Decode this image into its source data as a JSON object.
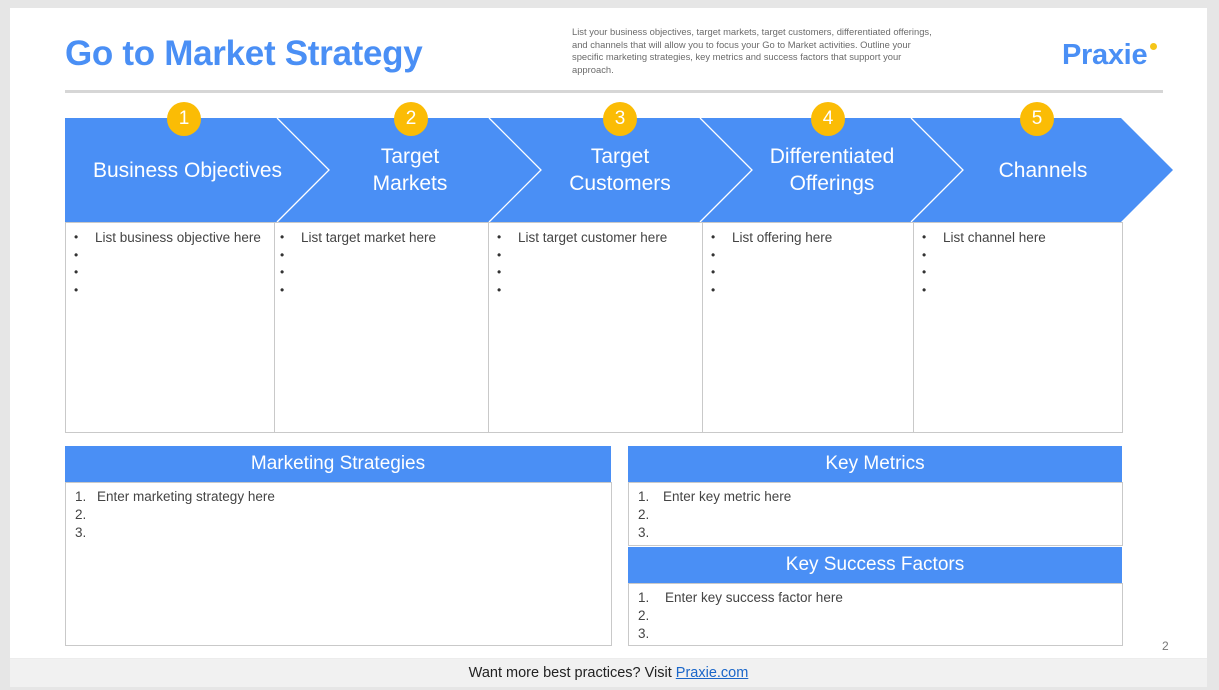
{
  "header": {
    "title": "Go to Market Strategy",
    "description": "List your business objectives, target markets, target customers, differentiated offerings, and channels that will allow you to focus your Go to Market activities. Outline your specific marketing strategies, key metrics and success factors that support your approach.",
    "logo": "Praxie"
  },
  "colors": {
    "accent_blue": "#4a8ff5",
    "badge_yellow": "#fbbc05",
    "border_gray": "#c9c9c9"
  },
  "stages": [
    {
      "number": "1",
      "label_lines": [
        "Business Objectives"
      ],
      "items": [
        "List business objective here",
        "",
        "",
        ""
      ]
    },
    {
      "number": "2",
      "label_lines": [
        "Target",
        "Markets"
      ],
      "items": [
        "List target market here",
        "",
        "",
        ""
      ]
    },
    {
      "number": "3",
      "label_lines": [
        "Target",
        "Customers"
      ],
      "items": [
        "List target customer here",
        "",
        "",
        ""
      ]
    },
    {
      "number": "4",
      "label_lines": [
        "Differentiated",
        "Offerings"
      ],
      "items": [
        "List offering here",
        "",
        "",
        ""
      ]
    },
    {
      "number": "5",
      "label_lines": [
        "Channels"
      ],
      "items": [
        "List channel here",
        "",
        "",
        ""
      ]
    }
  ],
  "panels": {
    "marketing_strategies": {
      "title": "Marketing Strategies",
      "items": [
        {
          "num": "1.",
          "text": "Enter marketing strategy here"
        },
        {
          "num": "2.",
          "text": ""
        },
        {
          "num": "3.",
          "text": ""
        }
      ]
    },
    "key_metrics": {
      "title": "Key Metrics",
      "items": [
        {
          "num": "1.",
          "text": "Enter key metric here"
        },
        {
          "num": "2.",
          "text": ""
        },
        {
          "num": "3.",
          "text": ""
        }
      ]
    },
    "key_success_factors": {
      "title": "Key Success Factors",
      "items": [
        {
          "num": "1.",
          "text": "Enter key success factor here"
        },
        {
          "num": "2.",
          "text": ""
        },
        {
          "num": "3.",
          "text": ""
        }
      ]
    }
  },
  "page_number": "2",
  "footer": {
    "text": "Want more best practices? Visit ",
    "link_text": "Praxie.com"
  }
}
